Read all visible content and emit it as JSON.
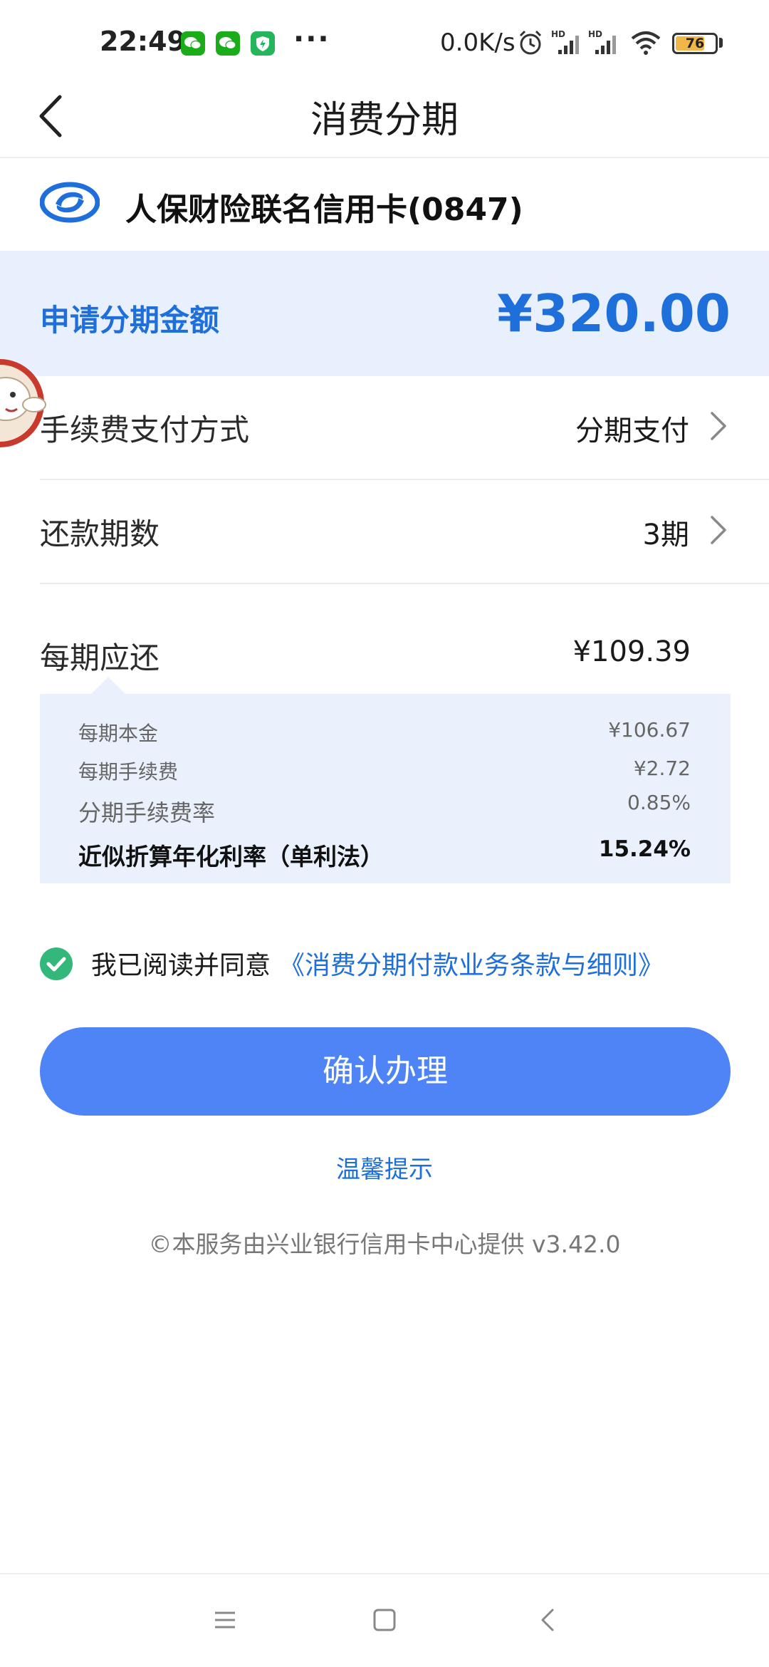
{
  "status_bar": {
    "time": "22:49",
    "more": "···",
    "net_speed": "0.0K/s",
    "battery_level": "76",
    "icons": [
      "wechat-icon",
      "wechat-icon",
      "security-app-icon",
      "alarm-icon",
      "hd-signal-icon",
      "hd-signal-icon",
      "wifi-icon",
      "battery-icon"
    ]
  },
  "header": {
    "title": "消费分期"
  },
  "card": {
    "name": "人保财险联名信用卡(0847)"
  },
  "amount": {
    "label": "申请分期金额",
    "value": "¥320.00",
    "color": "#1e6fd9"
  },
  "rows": {
    "fee_method": {
      "label": "手续费支付方式",
      "value": "分期支付"
    },
    "periods": {
      "label": "还款期数",
      "value": "3期"
    },
    "per_period": {
      "label": "每期应还",
      "value": "¥109.39"
    }
  },
  "details": {
    "principal": {
      "label": "每期本金",
      "value": "¥106.67"
    },
    "fee": {
      "label": "每期手续费",
      "value": "¥2.72"
    },
    "fee_rate": {
      "label": "分期手续费率",
      "value": "0.85%"
    },
    "apr": {
      "label": "近似折算年化利率（单利法）",
      "value": "15.24%"
    }
  },
  "agreement": {
    "checked": true,
    "text": "我已阅读并同意",
    "link": "《消费分期付款业务条款与细则》"
  },
  "confirm_button": "确认办理",
  "tips_link": "温馨提示",
  "footer_note": "©本服务由兴业银行信用卡中心提供 v3.42.0",
  "nav": {
    "icons": [
      "menu-icon",
      "home-icon",
      "back-icon"
    ]
  },
  "colors": {
    "accent": "#4f84f7",
    "link": "#1e6fd9",
    "band": "#e8f0fd",
    "check": "#33b77a"
  }
}
